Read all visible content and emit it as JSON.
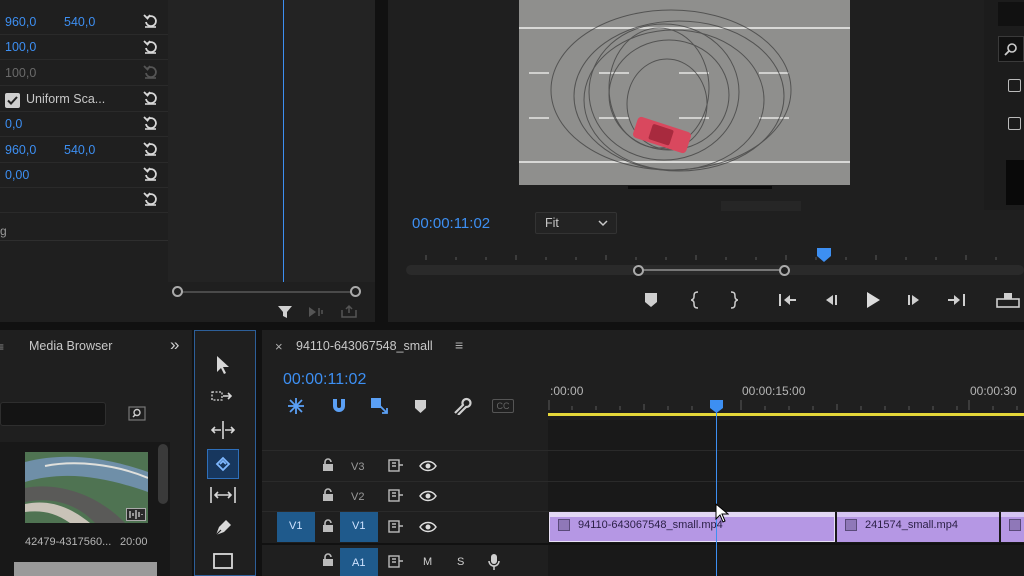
{
  "effect_controls": {
    "rows": [
      {
        "v1": "960,0",
        "v2": "540,0",
        "dim": false
      },
      {
        "v1": "100,0",
        "v2": "",
        "dim": false
      },
      {
        "v1": "100,0",
        "v2": "",
        "dim": true
      },
      {
        "v1": "",
        "v2": "",
        "dim": false,
        "checkbox_label": "Uniform Sca..."
      },
      {
        "v1": "0,0",
        "v2": "",
        "dim": false
      },
      {
        "v1": "960,0",
        "v2": "540,0",
        "dim": false
      },
      {
        "v1": "0,00",
        "v2": "",
        "dim": false
      },
      {
        "v1": "",
        "v2": "",
        "dim": false
      }
    ],
    "cut_label": "g"
  },
  "program_monitor": {
    "timecode": "00:00:11:02",
    "fit_option": "Fit"
  },
  "project_panel": {
    "tab_label": "Media Browser",
    "thumb_name": "42479-4317560...",
    "thumb_duration": "20:00"
  },
  "timeline": {
    "sequence_name": "94110-643067548_small",
    "timecode": "00:00:11:02",
    "ruler_labels": [
      ":00:00",
      "00:00:15:00",
      "00:00:30"
    ],
    "tracks": {
      "v3": "V3",
      "v2": "V2",
      "v1_source": "V1",
      "v1": "V1",
      "a1": "A1",
      "mute": "M",
      "solo": "S"
    },
    "clips": [
      {
        "name": "94110-643067548_small.mp4"
      },
      {
        "name": "241574_small.mp4"
      }
    ]
  },
  "colors": {
    "accent_blue": "#3d8ff2",
    "clip_purple": "#b597e4",
    "work_area_yellow": "#e6d83a"
  }
}
